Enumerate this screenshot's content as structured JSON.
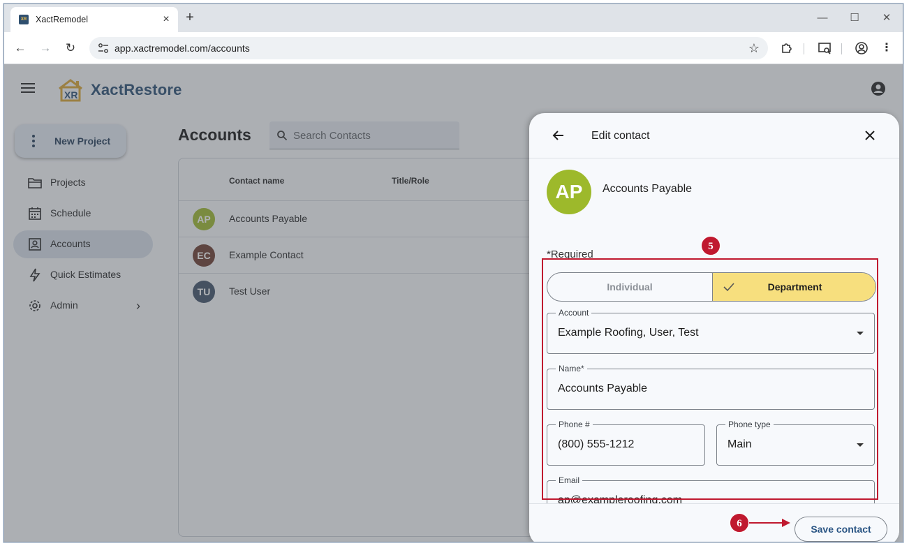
{
  "browser": {
    "tab_title": "XactRemodel",
    "favicon_text": "XR",
    "url": "app.xactremodel.com/accounts"
  },
  "app": {
    "logo_mark": "XR",
    "logo_text": "XactRestore",
    "fab_label": "New Project",
    "nav": [
      {
        "label": "Projects",
        "icon": "folder-icon"
      },
      {
        "label": "Schedule",
        "icon": "calendar-icon"
      },
      {
        "label": "Accounts",
        "icon": "contacts-icon",
        "active": true
      },
      {
        "label": "Quick Estimates",
        "icon": "lightning-icon"
      },
      {
        "label": "Admin",
        "icon": "gear-icon"
      }
    ]
  },
  "accounts": {
    "title": "Accounts",
    "search_placeholder": "Search Contacts",
    "columns": [
      "Contact name",
      "Title/Role"
    ],
    "rows": [
      {
        "initials": "AP",
        "name": "Accounts Payable",
        "color": "#9db92b"
      },
      {
        "initials": "EC",
        "name": "Example Contact",
        "color": "#6b3a2d"
      },
      {
        "initials": "TU",
        "name": "Test User",
        "color": "#3d4f66"
      }
    ]
  },
  "drawer": {
    "title": "Edit contact",
    "avatar_initials": "AP",
    "contact_name": "Accounts Payable",
    "required_label": "*Required",
    "toggle": {
      "left": "Individual",
      "right": "Department",
      "selected": "Department"
    },
    "fields": {
      "account": {
        "label": "Account",
        "value": "Example Roofing, User, Test"
      },
      "name": {
        "label": "Name*",
        "value": "Accounts Payable"
      },
      "phone": {
        "label": "Phone #",
        "value": "(800) 555-1212"
      },
      "phone_type": {
        "label": "Phone type",
        "value": "Main"
      },
      "email": {
        "label": "Email",
        "value": "ap@exampleroofing.com"
      }
    },
    "save_label": "Save contact"
  },
  "annotations": {
    "step_5": "5",
    "step_6": "6",
    "color": "#c0192f"
  }
}
